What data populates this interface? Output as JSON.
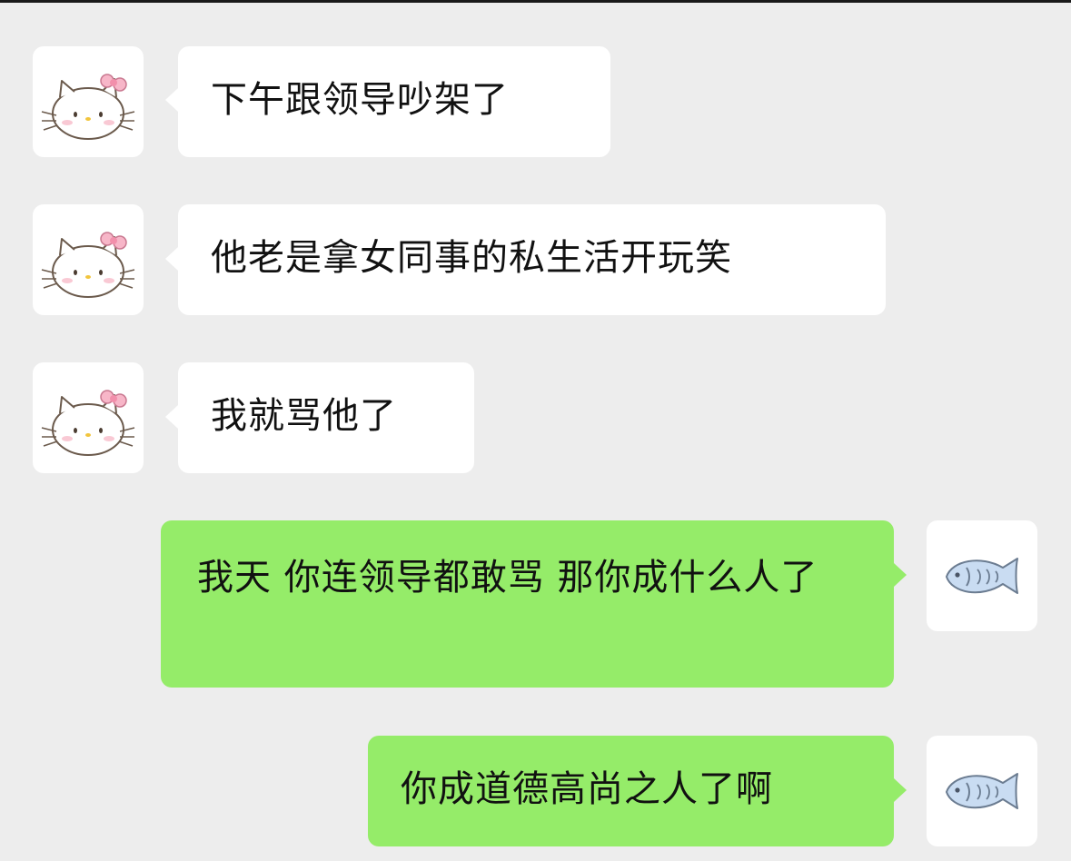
{
  "chat": {
    "messages": [
      {
        "sender": "other",
        "avatar": "hello-kitty-icon",
        "text": "下午跟领导吵架了"
      },
      {
        "sender": "other",
        "avatar": "hello-kitty-icon",
        "text": "他老是拿女同事的私生活开玩笑"
      },
      {
        "sender": "other",
        "avatar": "hello-kitty-icon",
        "text": "我就骂他了"
      },
      {
        "sender": "me",
        "avatar": "fish-icon",
        "text": "我天 你连领导都敢骂 那你成什么人了"
      },
      {
        "sender": "me",
        "avatar": "fish-icon",
        "text": "你成道德高尚之人了啊"
      }
    ]
  },
  "colors": {
    "background": "#ededed",
    "incoming_bubble": "#ffffff",
    "outgoing_bubble": "#95ec69",
    "text": "#111111"
  }
}
